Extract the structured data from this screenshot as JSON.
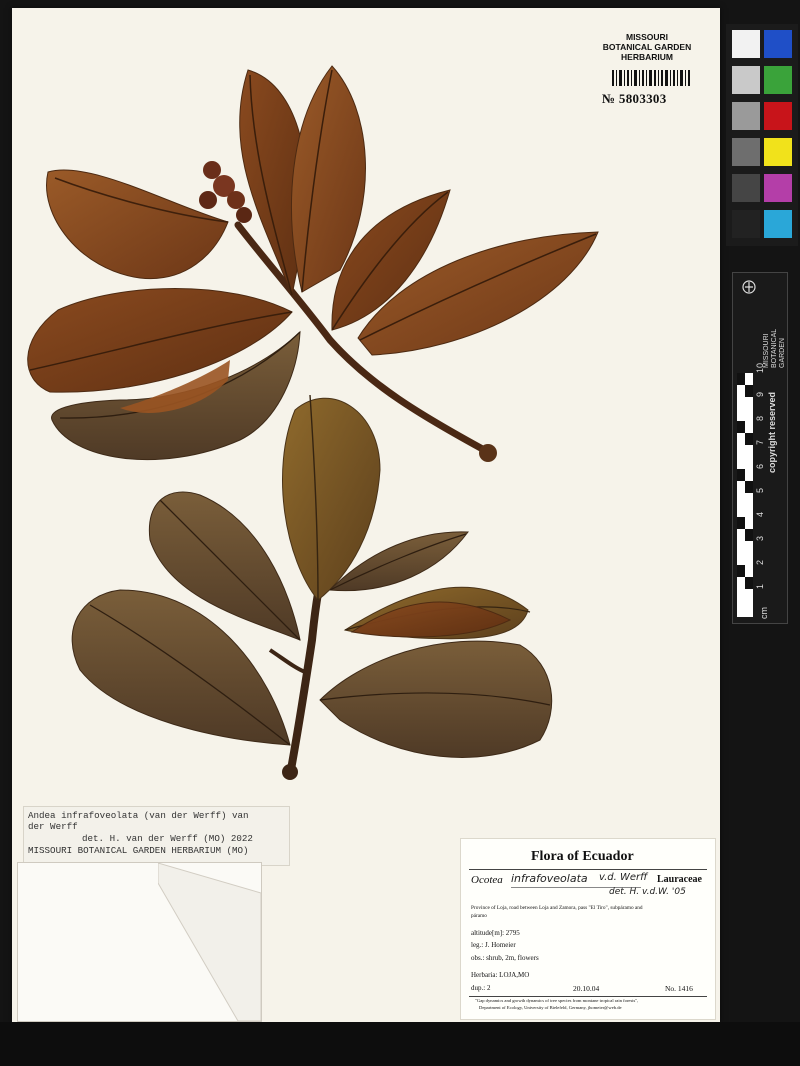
{
  "herbarium_label": {
    "line1": "MISSOURI",
    "line2": "BOTANICAL GARDEN",
    "line3": "HERBARIUM",
    "accession": "№ 5803303"
  },
  "ruler": {
    "brand_line1": "MISSOURI",
    "brand_line2": "BOTANICAL",
    "brand_line3": "GARDEN",
    "copyright": "copyright reserved",
    "unit": "cm",
    "ticks": [
      "1",
      "2",
      "3",
      "4",
      "5",
      "6",
      "7",
      "8",
      "9",
      "10"
    ]
  },
  "color_card": {
    "swatches": [
      "#f2f2f2",
      "#1f4fc7",
      "#c9c9c9",
      "#3aa33a",
      "#9a9a9a",
      "#c8141a",
      "#6e6e6e",
      "#f1e21b",
      "#454545",
      "#b43ea8",
      "#222222",
      "#2aa7d8"
    ]
  },
  "determination_slip": {
    "line1": "Andea infrafoveolata (van der Werff) van",
    "line2": "der Werff",
    "line3": "det. H. van der Werff (MO) 2022",
    "line4": "MISSOURI BOTANICAL GARDEN HERBARIUM (MO)"
  },
  "flora_label": {
    "title": "Flora of Ecuador",
    "genus": "Ocotea",
    "epithet_handwritten": "infrafoveolata",
    "author_handwritten": "v.d. Werff",
    "family": "Lauraceae",
    "det_handwritten": "det. H. v.d.W. '05",
    "locality_line1": "Province of Loja, road between Loja and Zamora, pass \"El Tiro\", subpáramo and",
    "locality_line2": "páramo",
    "altitude": "altitude[m]: 2795",
    "collector": "leg.: J. Homeier",
    "observations": "obs.: shrub, 2m, flowers",
    "herbaria": "Herbaria: LOJA,MO",
    "duplicates": "dup.: 2",
    "date": "20.10.04",
    "number": "No. 1416",
    "footer_line1": "\"Gap dynamics and growth dynamics of tree species from montane tropical rain forests\",",
    "footer_line2": "Department of Ecology, University of Bielefeld, Germany, jhomeier@web.de"
  }
}
